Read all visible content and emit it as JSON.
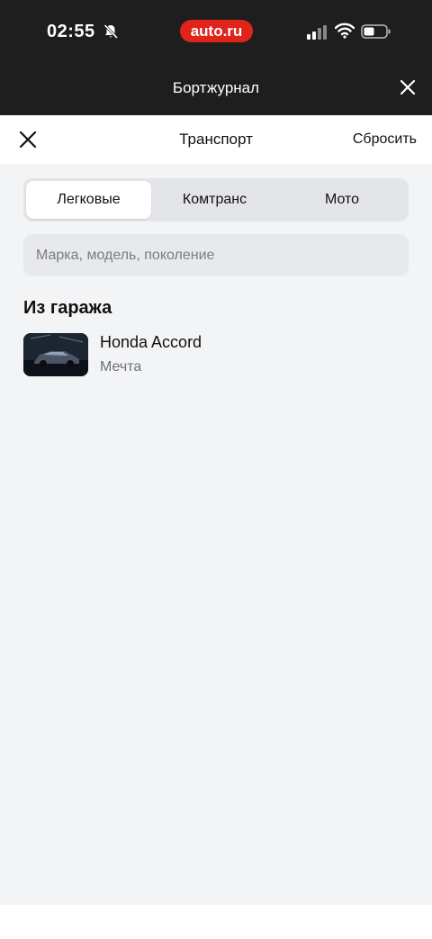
{
  "status_bar": {
    "time": "02:55",
    "brand": "auto.ru"
  },
  "header": {
    "title": "Бортжурнал"
  },
  "sheet": {
    "title": "Транспорт",
    "reset_label": "Сбросить",
    "tabs": [
      {
        "label": "Легковые",
        "active": true
      },
      {
        "label": "Комтранс",
        "active": false
      },
      {
        "label": "Мото",
        "active": false
      }
    ],
    "search": {
      "placeholder": "Марка, модель, поколение",
      "value": ""
    },
    "garage": {
      "title": "Из гаража",
      "items": [
        {
          "name": "Honda Accord",
          "subtitle": "Мечта"
        }
      ]
    }
  },
  "colors": {
    "brand_red": "#e0231b",
    "dark_header": "#1e1e1e",
    "sheet_bg": "#f3f4f6"
  }
}
